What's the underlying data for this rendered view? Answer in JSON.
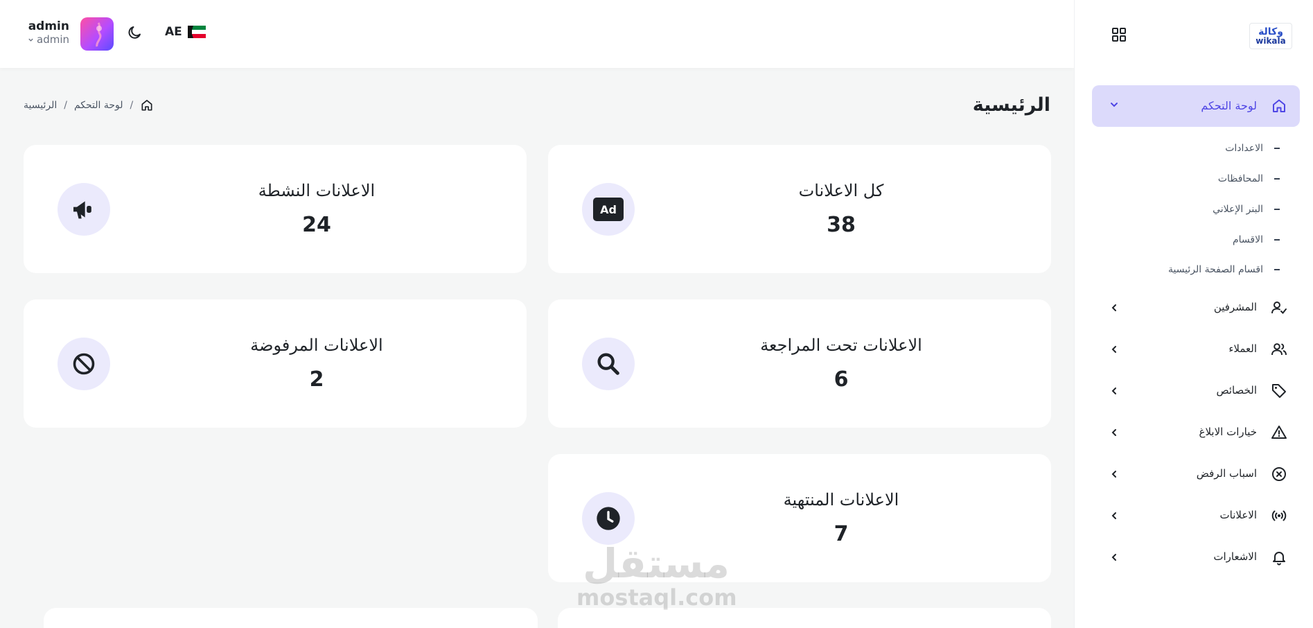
{
  "header": {
    "user_name": "admin",
    "user_role": "admin",
    "language_code": "AE",
    "theme_icon": "moon-icon",
    "flag_icon": "uae-flag-icon"
  },
  "page": {
    "title": "الرئيسية",
    "breadcrumb": {
      "home_icon": "home-icon",
      "separator": "/",
      "items": [
        "لوحة التحكم",
        "الرئيسية"
      ]
    }
  },
  "stats": [
    {
      "label": "كل الاعلانات",
      "value": "38",
      "icon": "ad-icon"
    },
    {
      "label": "الاعلانات النشطة",
      "value": "24",
      "icon": "megaphone-icon"
    },
    {
      "label": "الاعلانات تحت المراجعة",
      "value": "6",
      "icon": "search-icon"
    },
    {
      "label": "الاعلانات المرفوضة",
      "value": "2",
      "icon": "ban-icon"
    },
    {
      "label": "الاعلانات المنتهية",
      "value": "7",
      "icon": "clock-icon"
    }
  ],
  "watermark": {
    "arabic": "مستقل",
    "latin": "mostaql.com"
  },
  "sidebar": {
    "logo_ar": "وكالة",
    "logo_en": "wikala",
    "active_item": {
      "label": "لوحة التحكم",
      "icon": "home-icon"
    },
    "sub_items": [
      "الاعدادات",
      "المحافظات",
      "البنر الإعلاني",
      "الاقسام",
      "اقسام الصفحة الرئيسية"
    ],
    "items": [
      {
        "label": "المشرفين",
        "icon": "user-check-icon"
      },
      {
        "label": "العملاء",
        "icon": "users-icon"
      },
      {
        "label": "الخصائص",
        "icon": "tag-icon"
      },
      {
        "label": "خيارات الابلاغ",
        "icon": "warning-icon"
      },
      {
        "label": "اسباب الرفض",
        "icon": "x-circle-icon"
      },
      {
        "label": "الاعلانات",
        "icon": "broadcast-icon"
      },
      {
        "label": "الاشعارات",
        "icon": "bell-icon"
      }
    ]
  },
  "colors": {
    "accent": "#4f46e5",
    "accent_bg": "#dcdafb",
    "icon_bg": "#ebeafc",
    "page_bg": "#f5f6f6"
  }
}
